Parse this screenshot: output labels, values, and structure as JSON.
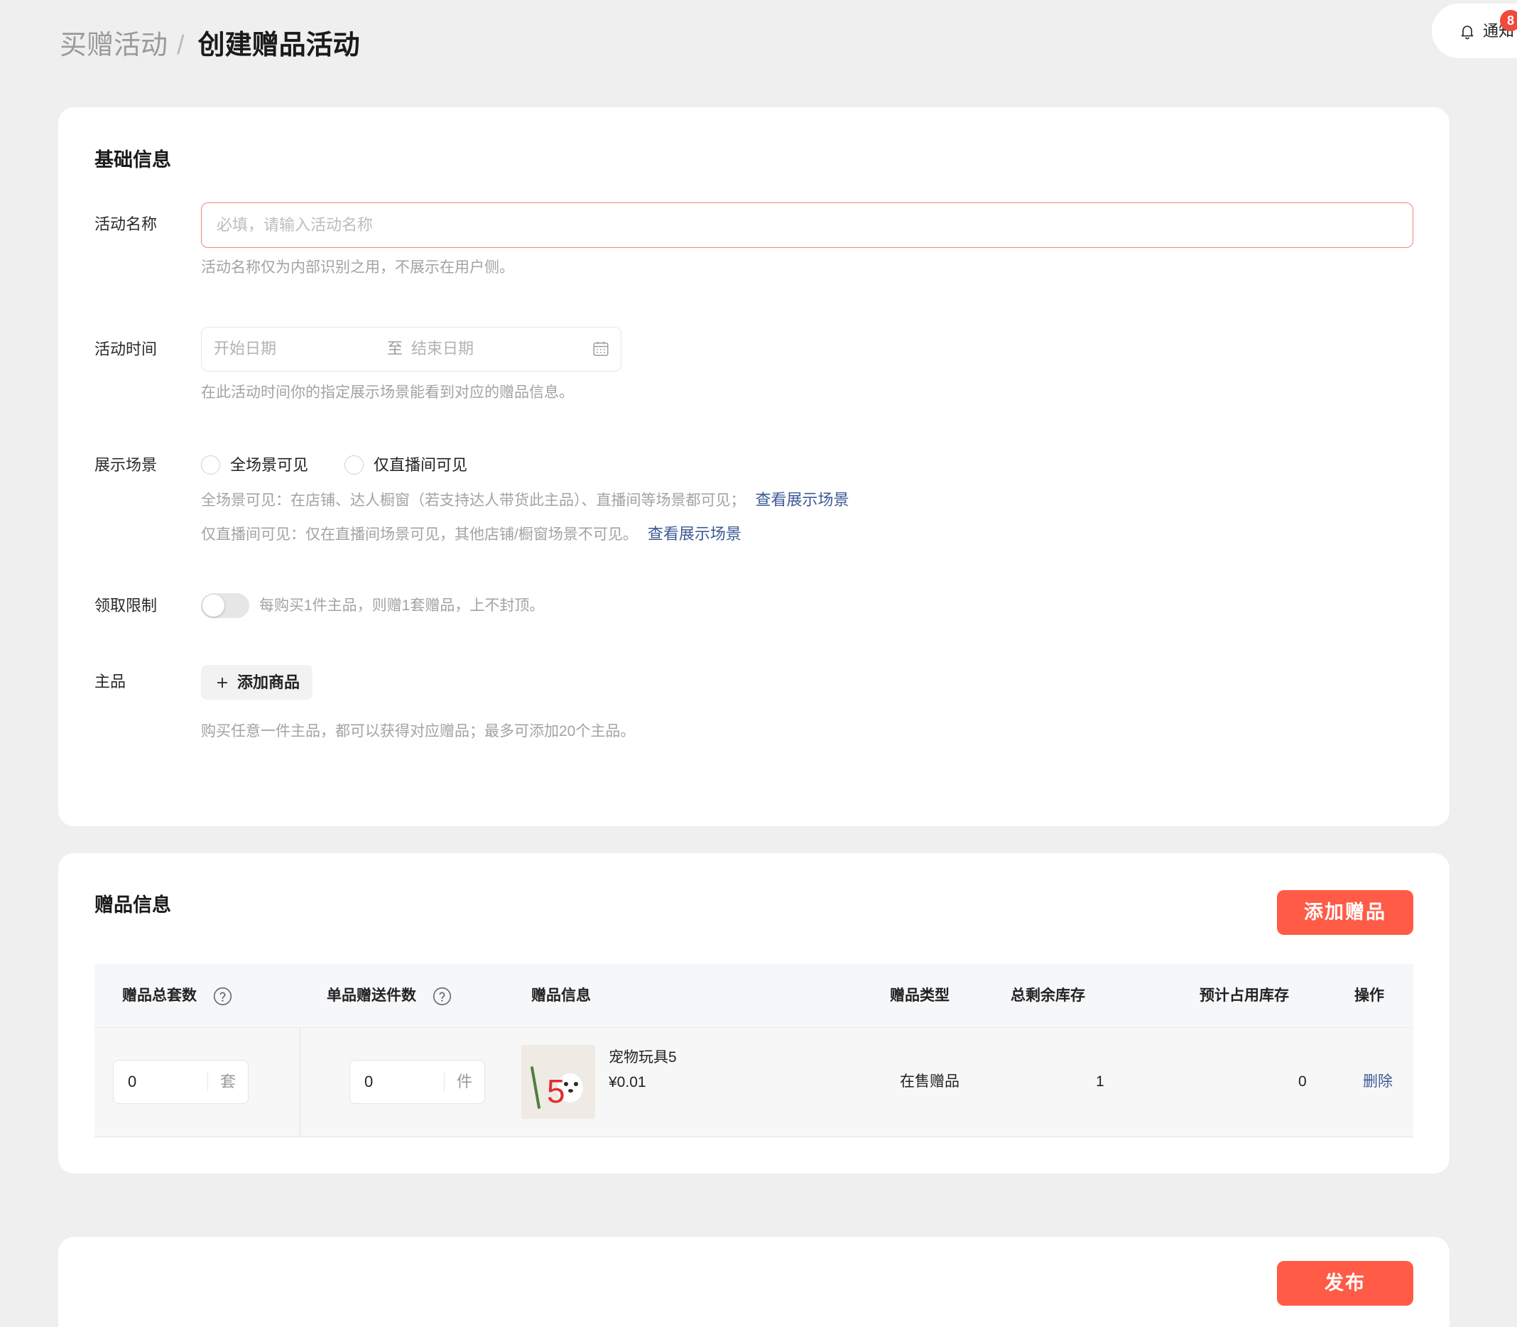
{
  "breadcrumb": {
    "parent": "买赠活动",
    "separator": "/",
    "current": "创建赠品活动"
  },
  "notification": {
    "label": "通知",
    "badge": "8",
    "icon": "bell-icon"
  },
  "colors": {
    "primary": "#ff5b46",
    "link": "#3d5a94",
    "error_border": "#f2837a",
    "background": "#efefef",
    "badge": "#f04a3a"
  },
  "basic_info": {
    "title": "基础信息",
    "name_field": {
      "label": "活动名称",
      "value": "",
      "placeholder": "必填，请输入活动名称",
      "help": "活动名称仅为内部识别之用，不展示在用户侧。"
    },
    "time_field": {
      "label": "活动时间",
      "start_placeholder": "开始日期",
      "separator": "至",
      "end_placeholder": "结束日期",
      "icon": "calendar-icon",
      "help": "在此活动时间你的指定展示场景能看到对应的赠品信息。"
    },
    "scene_field": {
      "label": "展示场景",
      "options": [
        {
          "label": "全场景可见",
          "selected": false
        },
        {
          "label": "仅直播间可见",
          "selected": false
        }
      ],
      "help_lines": [
        {
          "text": "全场景可见：在店铺、达人橱窗（若支持达人带货此主品）、直播间等场景都可见；",
          "link": "查看展示场景"
        },
        {
          "text": "仅直播间可见：仅在直播间场景可见，其他店铺/橱窗场景不可见。",
          "link": "查看展示场景"
        }
      ]
    },
    "limit_field": {
      "label": "领取限制",
      "enabled": false,
      "description": "每购买1件主品，则赠1套赠品，上不封顶。"
    },
    "main_product_field": {
      "label": "主品",
      "add_button": "添加商品",
      "add_icon": "plus-icon",
      "help": "购买任意一件主品，都可以获得对应赠品；最多可添加20个主品。"
    }
  },
  "gift_info": {
    "title": "赠品信息",
    "add_button": "添加赠品",
    "table": {
      "columns": [
        {
          "label": "赠品总套数",
          "icon": "question-circle-icon"
        },
        {
          "label": "单品赠送件数",
          "icon": "question-circle-icon"
        },
        {
          "label": "赠品信息"
        },
        {
          "label": "赠品类型"
        },
        {
          "label": "总剩余库存"
        },
        {
          "label": "预计占用库存"
        },
        {
          "label": "操作"
        }
      ],
      "rows": [
        {
          "total_sets": "0",
          "total_sets_unit": "套",
          "per_item_count": "0",
          "per_item_unit": "件",
          "gift_image_label": "5",
          "gift_name": "宠物玩具5",
          "gift_price": "¥0.01",
          "gift_type": "在售赠品",
          "remaining_stock": "1",
          "estimated_stock": "0",
          "action": "删除"
        }
      ]
    }
  },
  "footer": {
    "publish_button": "发布"
  }
}
